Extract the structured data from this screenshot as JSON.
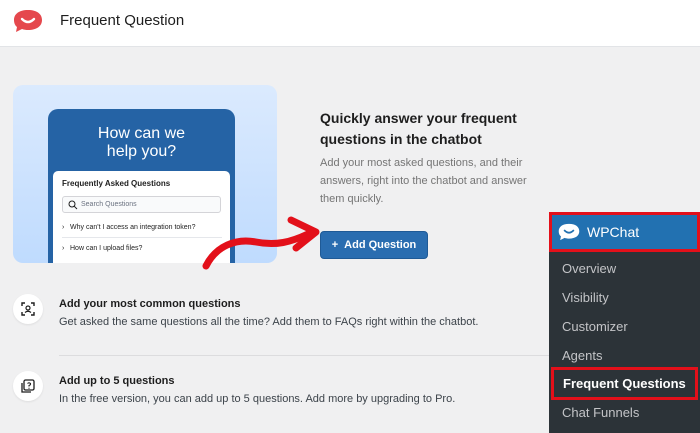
{
  "header": {
    "title": "Frequent Question"
  },
  "hero": {
    "phone_title": "How can we help you?",
    "card_title": "Frequently Asked Questions",
    "search_placeholder": "Search Questions",
    "questions": [
      "Why can't I access an integration token?",
      "How can I upload files?"
    ]
  },
  "main": {
    "heading": "Quickly answer your frequent questions in the chatbot",
    "description": "Add your most asked questions, and their answers, right into the chatbot and answer them quickly.",
    "add_button_label": "Add Question"
  },
  "features": [
    {
      "icon": "scan-icon",
      "title": "Add your most common questions",
      "description": "Get asked the same questions all the time? Add them to FAQs right within the chatbot."
    },
    {
      "icon": "question-box-icon",
      "title": "Add up to 5 questions",
      "description": "In the free version, you can add up to 5 questions. Add more by upgrading to Pro."
    }
  ],
  "wp_menu": {
    "title": "WPChat",
    "items": [
      "Overview",
      "Visibility",
      "Customizer",
      "Agents"
    ],
    "active_item": "Frequent Questions",
    "after_items": [
      "Chat Funnels"
    ]
  },
  "colors": {
    "brand_red": "#e5484d",
    "button_blue": "#2a6db0",
    "wp_sidebar": "#2c3338",
    "highlight_red": "#e3101a"
  }
}
